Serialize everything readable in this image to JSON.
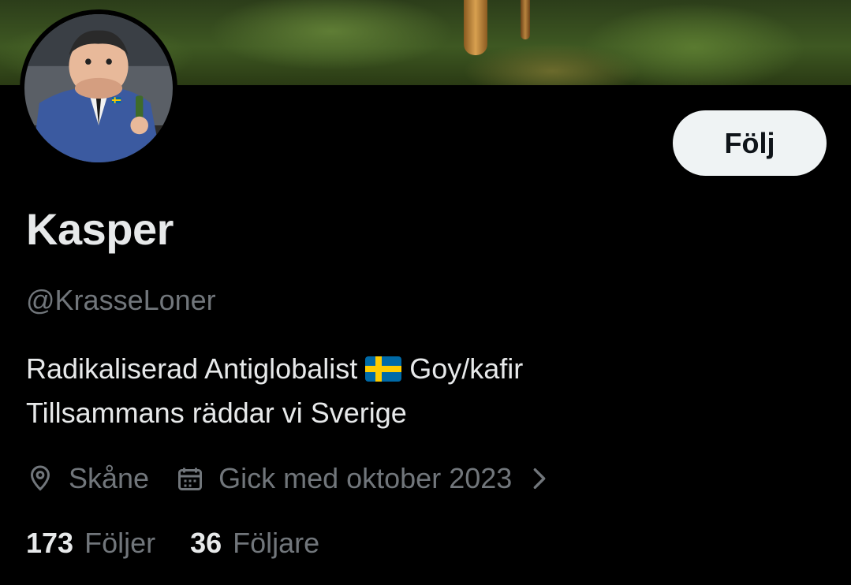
{
  "profile": {
    "display_name": "Kasper",
    "handle": "@KrasseLoner",
    "bio_line1_part1": "Radikaliserad Antiglobalist",
    "bio_line1_part2": "Goy/kafir",
    "bio_line2": "Tillsammans räddar vi Sverige",
    "location": "Skåne",
    "joined": "Gick med oktober 2023",
    "following_count": "173",
    "following_label": "Följer",
    "followers_count": "36",
    "followers_label": "Följare"
  },
  "actions": {
    "follow_label": "Följ"
  },
  "icons": {
    "location": "location-pin-icon",
    "joined": "calendar-icon",
    "more": "chevron-right-icon",
    "flag": "sweden-flag-emoji"
  },
  "colors": {
    "background": "#000000",
    "primary_text": "#e7e9ea",
    "secondary_text": "#71767b",
    "button_bg": "#eff3f4",
    "button_text": "#0f1419"
  }
}
